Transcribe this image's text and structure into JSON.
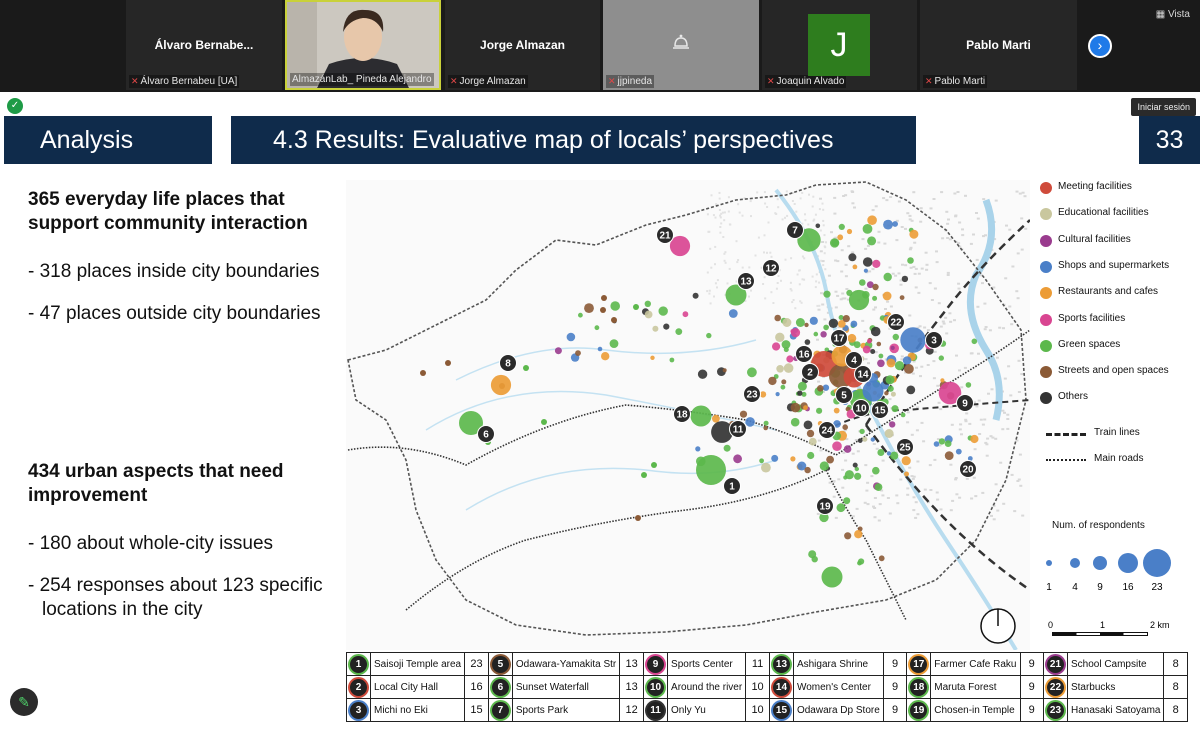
{
  "meeting": {
    "view_label": "Vista",
    "sign_in": "Iniciar sesión",
    "participants": [
      {
        "name": "Álvaro  Bernabe...",
        "label": "Álvaro Bernabeu [UA]"
      },
      {
        "name": "",
        "label": "AlmazánLab_ Pineda Alejandro"
      },
      {
        "name": "Jorge Almazan",
        "label": "Jorge Almazan"
      },
      {
        "name": "",
        "label": "jjpineda"
      },
      {
        "name": "J",
        "label": "Joaquin Alvado"
      },
      {
        "name": "Pablo Marti",
        "label": "Pablo Marti"
      }
    ]
  },
  "slide": {
    "section": "Analysis",
    "title": "4.3 Results: Evaluative map of locals’ perspectives",
    "page_number": "33",
    "blocks": {
      "heading1_line1": "365 everyday life places that",
      "heading1_line2": "support community interaction",
      "item1": "- 318 places inside city boundaries",
      "item2": "- 47 places outside city boundaries",
      "heading2_line1": "434 urban aspects that need",
      "heading2_line2": "improvement",
      "item3": "- 180 about whole-city issues",
      "item4_line1": "- 254 responses about 123 specific",
      "item4_line2": "locations in the city"
    },
    "legend": {
      "categories": [
        {
          "label": "Meeting facilities",
          "color": "#cf4b3b"
        },
        {
          "label": "Educational facilities",
          "color": "#c9c79e"
        },
        {
          "label": "Cultural facilities",
          "color": "#9a3b8e"
        },
        {
          "label": "Shops and supermarkets",
          "color": "#4a7fc8"
        },
        {
          "label": "Restaurants and cafes",
          "color": "#ec9c36"
        },
        {
          "label": "Sports facilities",
          "color": "#d94591"
        },
        {
          "label": "Green spaces",
          "color": "#5cb84c"
        },
        {
          "label": "Streets and open spaces",
          "color": "#8b5a36"
        },
        {
          "label": "Others",
          "color": "#333333"
        }
      ],
      "lines": [
        "Train lines",
        "Main roads"
      ],
      "size_title": "Num. of respondents",
      "sizes": [
        "1",
        "4",
        "9",
        "16",
        "23"
      ],
      "scale": {
        "zero": "0",
        "one": "1",
        "two": "2 km"
      }
    },
    "map_labels": [
      "1",
      "2",
      "3",
      "4",
      "5",
      "6",
      "7",
      "8",
      "9",
      "10",
      "11",
      "12",
      "13",
      "14",
      "15",
      "16",
      "17",
      "18",
      "19",
      "20",
      "21",
      "22",
      "23",
      "24",
      "25"
    ],
    "table": [
      [
        {
          "n": "1",
          "name": "Saisoji Temple area",
          "v": "23",
          "color": "#5cb84c"
        },
        {
          "n": "5",
          "name": "Odawara-Yamakita Str",
          "v": "13",
          "color": "#8b5a36"
        },
        {
          "n": "9",
          "name": "Sports Center",
          "v": "11",
          "color": "#d94591"
        },
        {
          "n": "13",
          "name": "Ashigara Shrine",
          "v": "9",
          "color": "#5cb84c"
        },
        {
          "n": "17",
          "name": "Farmer Cafe Raku",
          "v": "9",
          "color": "#ec9c36"
        },
        {
          "n": "21",
          "name": "School Campsite",
          "v": "8",
          "color": "#9a3b8e"
        }
      ],
      [
        {
          "n": "2",
          "name": "Local City Hall",
          "v": "16",
          "color": "#cf4b3b"
        },
        {
          "n": "6",
          "name": "Sunset Waterfall",
          "v": "13",
          "color": "#5cb84c"
        },
        {
          "n": "10",
          "name": "Around the river",
          "v": "10",
          "color": "#5cb84c"
        },
        {
          "n": "14",
          "name": "Women's Center",
          "v": "9",
          "color": "#cf4b3b"
        },
        {
          "n": "18",
          "name": "Maruta Forest",
          "v": "9",
          "color": "#5cb84c"
        },
        {
          "n": "22",
          "name": "Starbucks",
          "v": "8",
          "color": "#ec9c36"
        }
      ],
      [
        {
          "n": "3",
          "name": "Michi no Eki",
          "v": "15",
          "color": "#4a7fc8"
        },
        {
          "n": "7",
          "name": "Sports Park",
          "v": "12",
          "color": "#5cb84c"
        },
        {
          "n": "11",
          "name": "Only Yu",
          "v": "10",
          "color": "#333333"
        },
        {
          "n": "15",
          "name": "Odawara Dp Store",
          "v": "9",
          "color": "#4a7fc8"
        },
        {
          "n": "19",
          "name": "Chosen-in Temple",
          "v": "9",
          "color": "#5cb84c"
        },
        {
          "n": "23",
          "name": "Hanasaki Satoyama",
          "v": "8",
          "color": "#5cb84c"
        }
      ]
    ]
  }
}
